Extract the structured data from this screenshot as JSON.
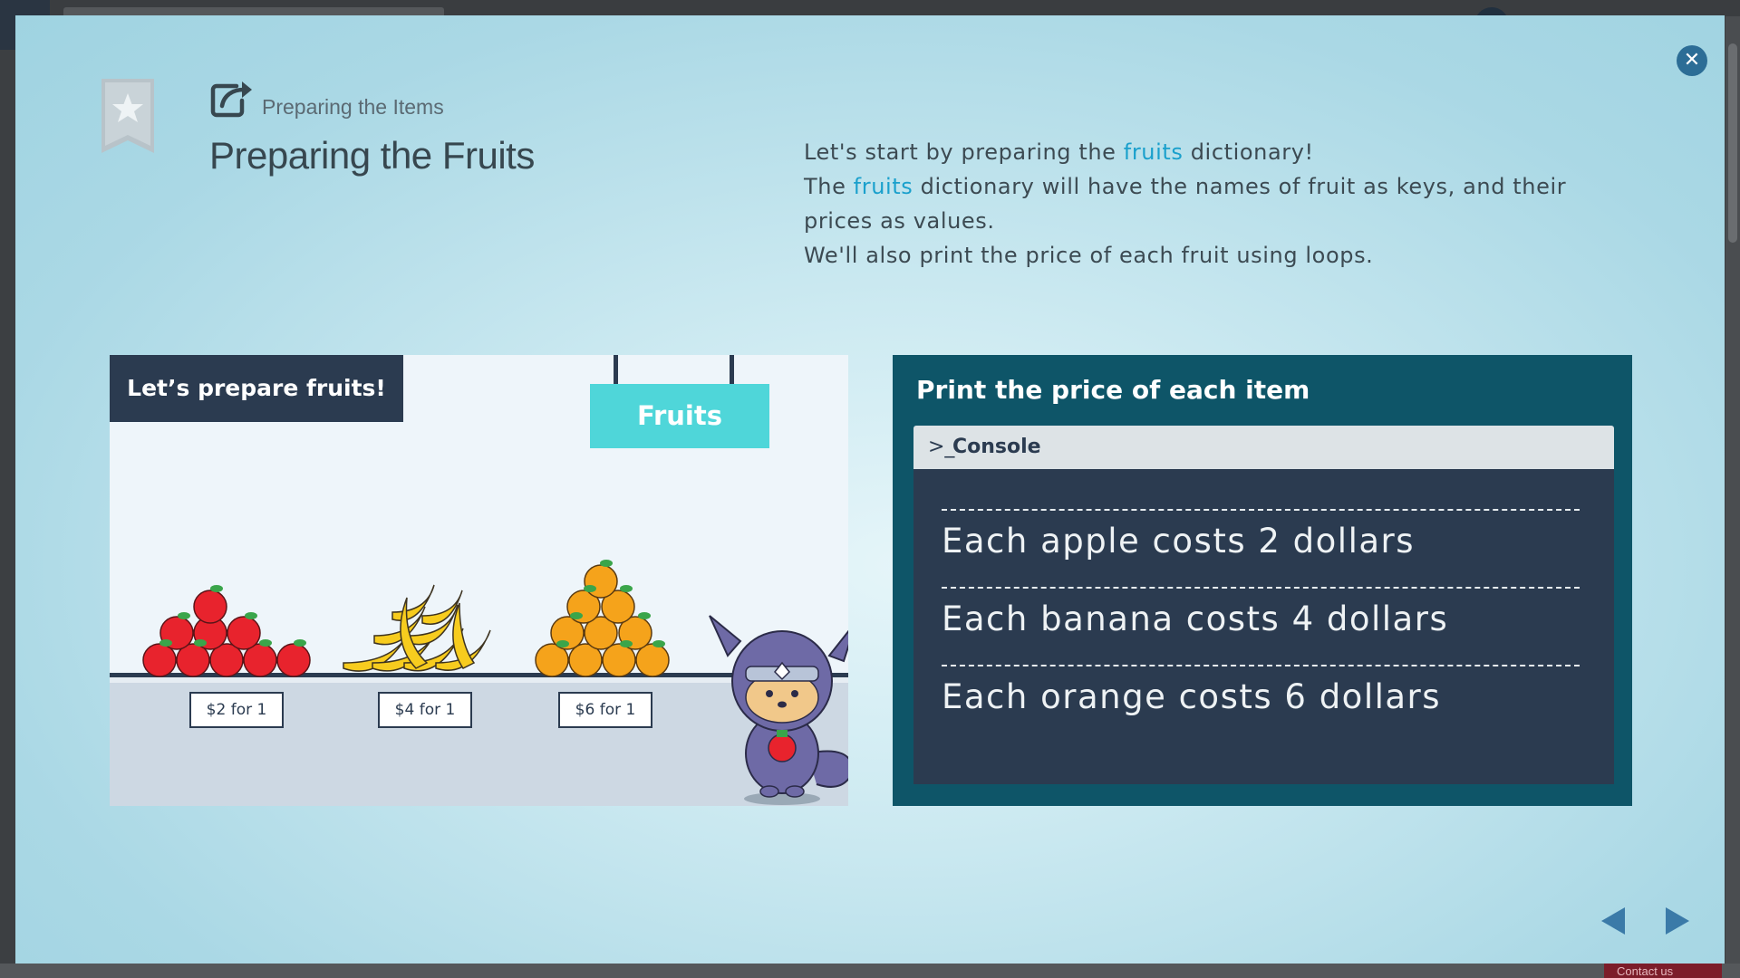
{
  "background": {
    "contact_label": "Contact us"
  },
  "modal": {
    "close_icon": "close-icon",
    "bookmark_icon": "star-bookmark-icon",
    "header_icon": "external-link-icon",
    "subtitle": "Preparing the Items",
    "title": "Preparing the Fruits",
    "description": {
      "line1_pre": "Let's start by preparing the ",
      "line1_kw": "fruits",
      "line1_post": " dictionary!",
      "line2_pre": "The ",
      "line2_kw": "fruits",
      "line2_post": " dictionary will have the names of fruit as keys, and their prices as values.",
      "line3": "We'll also print the price of each fruit using loops."
    },
    "keyword_color": "#1aa0cc"
  },
  "illustration": {
    "banner": "Let’s prepare fruits!",
    "sign": "Fruits",
    "price_tags": [
      "$2 for 1",
      "$4 for 1",
      "$6 for 1"
    ],
    "items": [
      "apples",
      "bananas",
      "oranges"
    ],
    "mascot": "ninja-dog-mascot"
  },
  "console_panel": {
    "title": "Print the price of each item",
    "bar_prompt": ">_",
    "bar_label": "Console",
    "lines": [
      "Each apple costs 2 dollars",
      "Each banana costs 4 dollars",
      "Each orange costs 6 dollars"
    ]
  },
  "navigation": {
    "prev_icon": "prev-arrow-icon",
    "next_icon": "next-arrow-icon"
  }
}
